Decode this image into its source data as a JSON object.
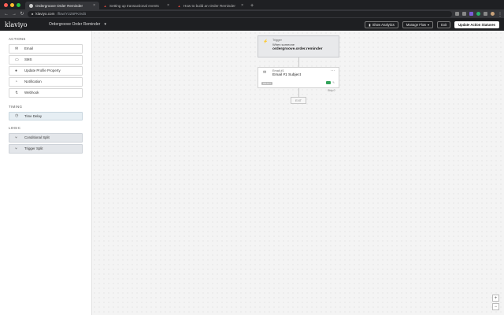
{
  "browser": {
    "tabs": [
      {
        "label": "Ordergroove Order Reminder",
        "active": true
      },
      {
        "label": "Setting up transactional events",
        "active": false
      },
      {
        "label": "How to build an Order Reminder",
        "active": false
      }
    ],
    "url_host": "klaviyo.com",
    "url_path": "/flow/Y2Z6PK/edit"
  },
  "app": {
    "logo": "klaviyo",
    "flow_name": "Ordergroove Order Reminder",
    "show_analytics": "Show Analytics",
    "manage_flow": "Manage Flow",
    "exit": "Exit",
    "update_statuses": "Update Action Statuses"
  },
  "sidebar": {
    "actions_title": "ACTIONS",
    "actions": [
      {
        "label": "Email",
        "icon": "envelope-icon"
      },
      {
        "label": "SMS",
        "icon": "sms-icon"
      },
      {
        "label": "Update Profile Property",
        "icon": "person-icon"
      },
      {
        "label": "Notification",
        "icon": "bell-icon"
      },
      {
        "label": "Webhook",
        "icon": "webhook-icon"
      }
    ],
    "timing_title": "TIMING",
    "timing": [
      {
        "label": "Time Delay",
        "icon": "clock-icon"
      }
    ],
    "logic_title": "LOGIC",
    "logic": [
      {
        "label": "Conditional Split",
        "icon": "split-icon"
      },
      {
        "label": "Trigger Split",
        "icon": "split-icon"
      }
    ]
  },
  "canvas": {
    "trigger_label": "Trigger",
    "trigger_when": "When someone",
    "trigger_event": "ordergroove.order.reminder",
    "email_label": "Email #1",
    "email_subject": "Email #1 Subject",
    "email_status": "DRAFT",
    "email_skip": "Skip 0",
    "exit_label": "EXIT"
  },
  "colors": {
    "accent_green": "#32a35a",
    "header_bg": "#1e1f22"
  }
}
